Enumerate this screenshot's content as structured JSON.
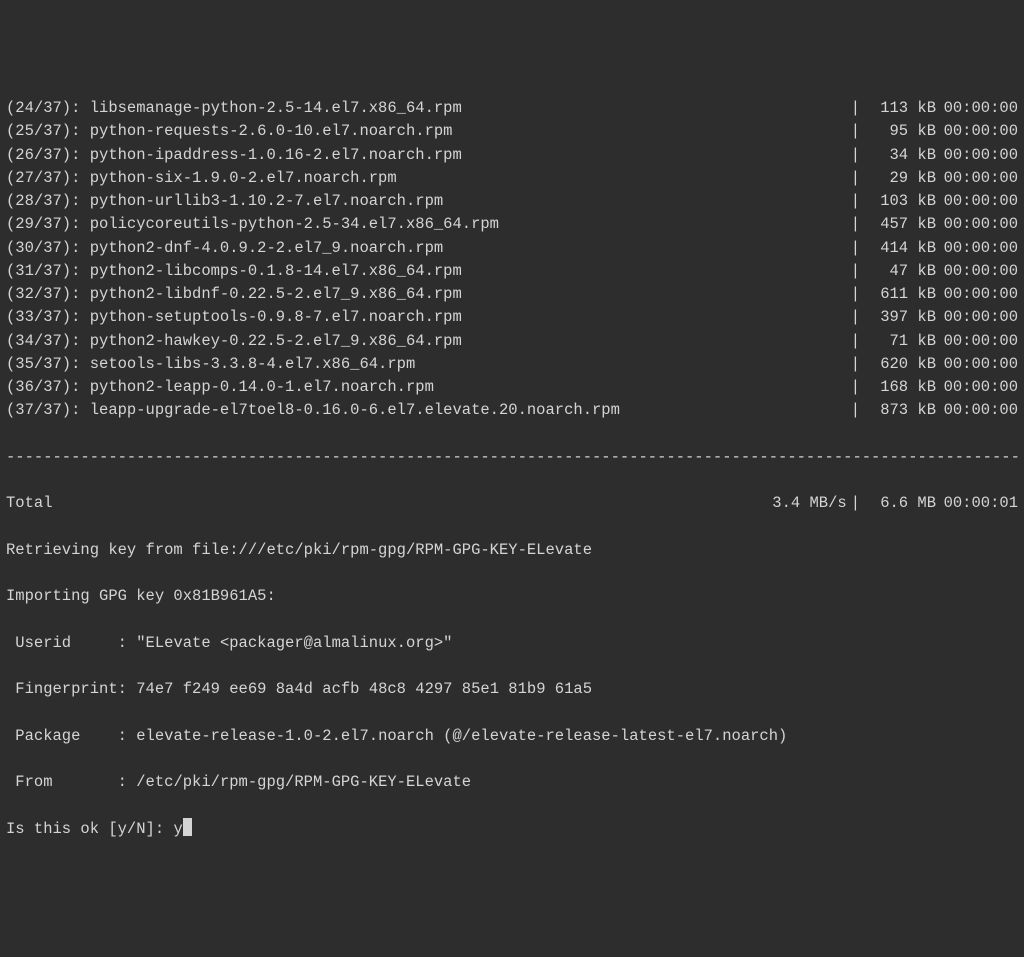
{
  "downloads": [
    {
      "counter": "(24/37): ",
      "name": "libsemanage-python-2.5-14.el7.x86_64.rpm",
      "size": "113 kB",
      "time": "00:00:00"
    },
    {
      "counter": "(25/37): ",
      "name": "python-requests-2.6.0-10.el7.noarch.rpm",
      "size": "95 kB",
      "time": "00:00:00"
    },
    {
      "counter": "(26/37): ",
      "name": "python-ipaddress-1.0.16-2.el7.noarch.rpm",
      "size": "34 kB",
      "time": "00:00:00"
    },
    {
      "counter": "(27/37): ",
      "name": "python-six-1.9.0-2.el7.noarch.rpm",
      "size": "29 kB",
      "time": "00:00:00"
    },
    {
      "counter": "(28/37): ",
      "name": "python-urllib3-1.10.2-7.el7.noarch.rpm",
      "size": "103 kB",
      "time": "00:00:00"
    },
    {
      "counter": "(29/37): ",
      "name": "policycoreutils-python-2.5-34.el7.x86_64.rpm",
      "size": "457 kB",
      "time": "00:00:00"
    },
    {
      "counter": "(30/37): ",
      "name": "python2-dnf-4.0.9.2-2.el7_9.noarch.rpm",
      "size": "414 kB",
      "time": "00:00:00"
    },
    {
      "counter": "(31/37): ",
      "name": "python2-libcomps-0.1.8-14.el7.x86_64.rpm",
      "size": "47 kB",
      "time": "00:00:00"
    },
    {
      "counter": "(32/37): ",
      "name": "python2-libdnf-0.22.5-2.el7_9.x86_64.rpm",
      "size": "611 kB",
      "time": "00:00:00"
    },
    {
      "counter": "(33/37): ",
      "name": "python-setuptools-0.9.8-7.el7.noarch.rpm",
      "size": "397 kB",
      "time": "00:00:00"
    },
    {
      "counter": "(34/37): ",
      "name": "python2-hawkey-0.22.5-2.el7_9.x86_64.rpm",
      "size": "71 kB",
      "time": "00:00:00"
    },
    {
      "counter": "(35/37): ",
      "name": "setools-libs-3.3.8-4.el7.x86_64.rpm",
      "size": "620 kB",
      "time": "00:00:00"
    },
    {
      "counter": "(36/37): ",
      "name": "python2-leapp-0.14.0-1.el7.noarch.rpm",
      "size": "168 kB",
      "time": "00:00:00"
    },
    {
      "counter": "(37/37): ",
      "name": "leapp-upgrade-el7toel8-0.16.0-6.el7.elevate.20.noarch.rpm",
      "size": "873 kB",
      "time": "00:00:00"
    }
  ],
  "separator": "--------------------------------------------------------------------------------------------------------------",
  "total": {
    "label": "Total",
    "speed": "3.4 MB/s",
    "size": "6.6 MB",
    "time": "00:00:01"
  },
  "gpg": {
    "retrieving": "Retrieving key from file:///etc/pki/rpm-gpg/RPM-GPG-KEY-ELevate",
    "importing": "Importing GPG key 0x81B961A5:",
    "userid_label": " Userid     : ",
    "userid_value": "\"ELevate <packager@almalinux.org>\"",
    "fingerprint_label": " Fingerprint: ",
    "fingerprint_value": "74e7 f249 ee69 8a4d acfb 48c8 4297 85e1 81b9 61a5",
    "package_label": " Package    : ",
    "package_value": "elevate-release-1.0-2.el7.noarch (@/elevate-release-latest-el7.noarch)",
    "from_label": " From       : ",
    "from_value": "/etc/pki/rpm-gpg/RPM-GPG-KEY-ELevate"
  },
  "prompt": {
    "text": "Is this ok [y/N]: ",
    "input": "y"
  },
  "pipe": "|"
}
